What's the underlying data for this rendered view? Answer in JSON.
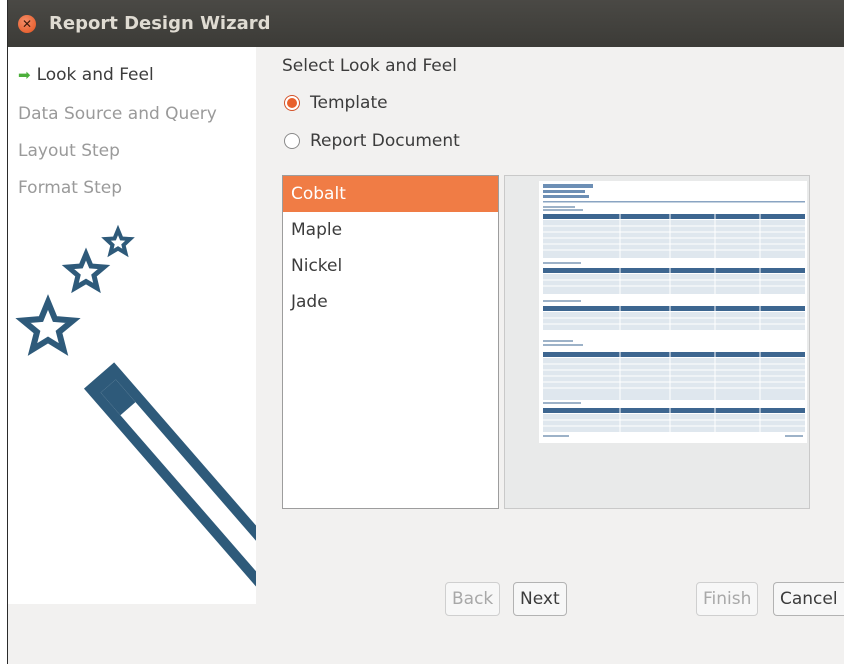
{
  "window": {
    "title": "Report Design Wizard"
  },
  "sidebar": {
    "steps": [
      {
        "label": "Look and Feel",
        "active": true
      },
      {
        "label": "Data Source and Query",
        "active": false
      },
      {
        "label": "Layout Step",
        "active": false
      },
      {
        "label": "Format Step",
        "active": false
      }
    ]
  },
  "main": {
    "heading": "Select Look and Feel",
    "options": [
      {
        "label": "Template",
        "checked": true
      },
      {
        "label": "Report Document",
        "checked": false
      }
    ],
    "templates": [
      "Cobalt",
      "Maple",
      "Nickel",
      "Jade"
    ],
    "selected_template": "Cobalt"
  },
  "footer": {
    "back_label": "Back",
    "next_label": "Next",
    "finish_label": "Finish",
    "cancel_label": "Cancel"
  },
  "colors": {
    "accent": "#e8602c",
    "selection": "#f07c45",
    "wand": "#2e5a7a"
  }
}
